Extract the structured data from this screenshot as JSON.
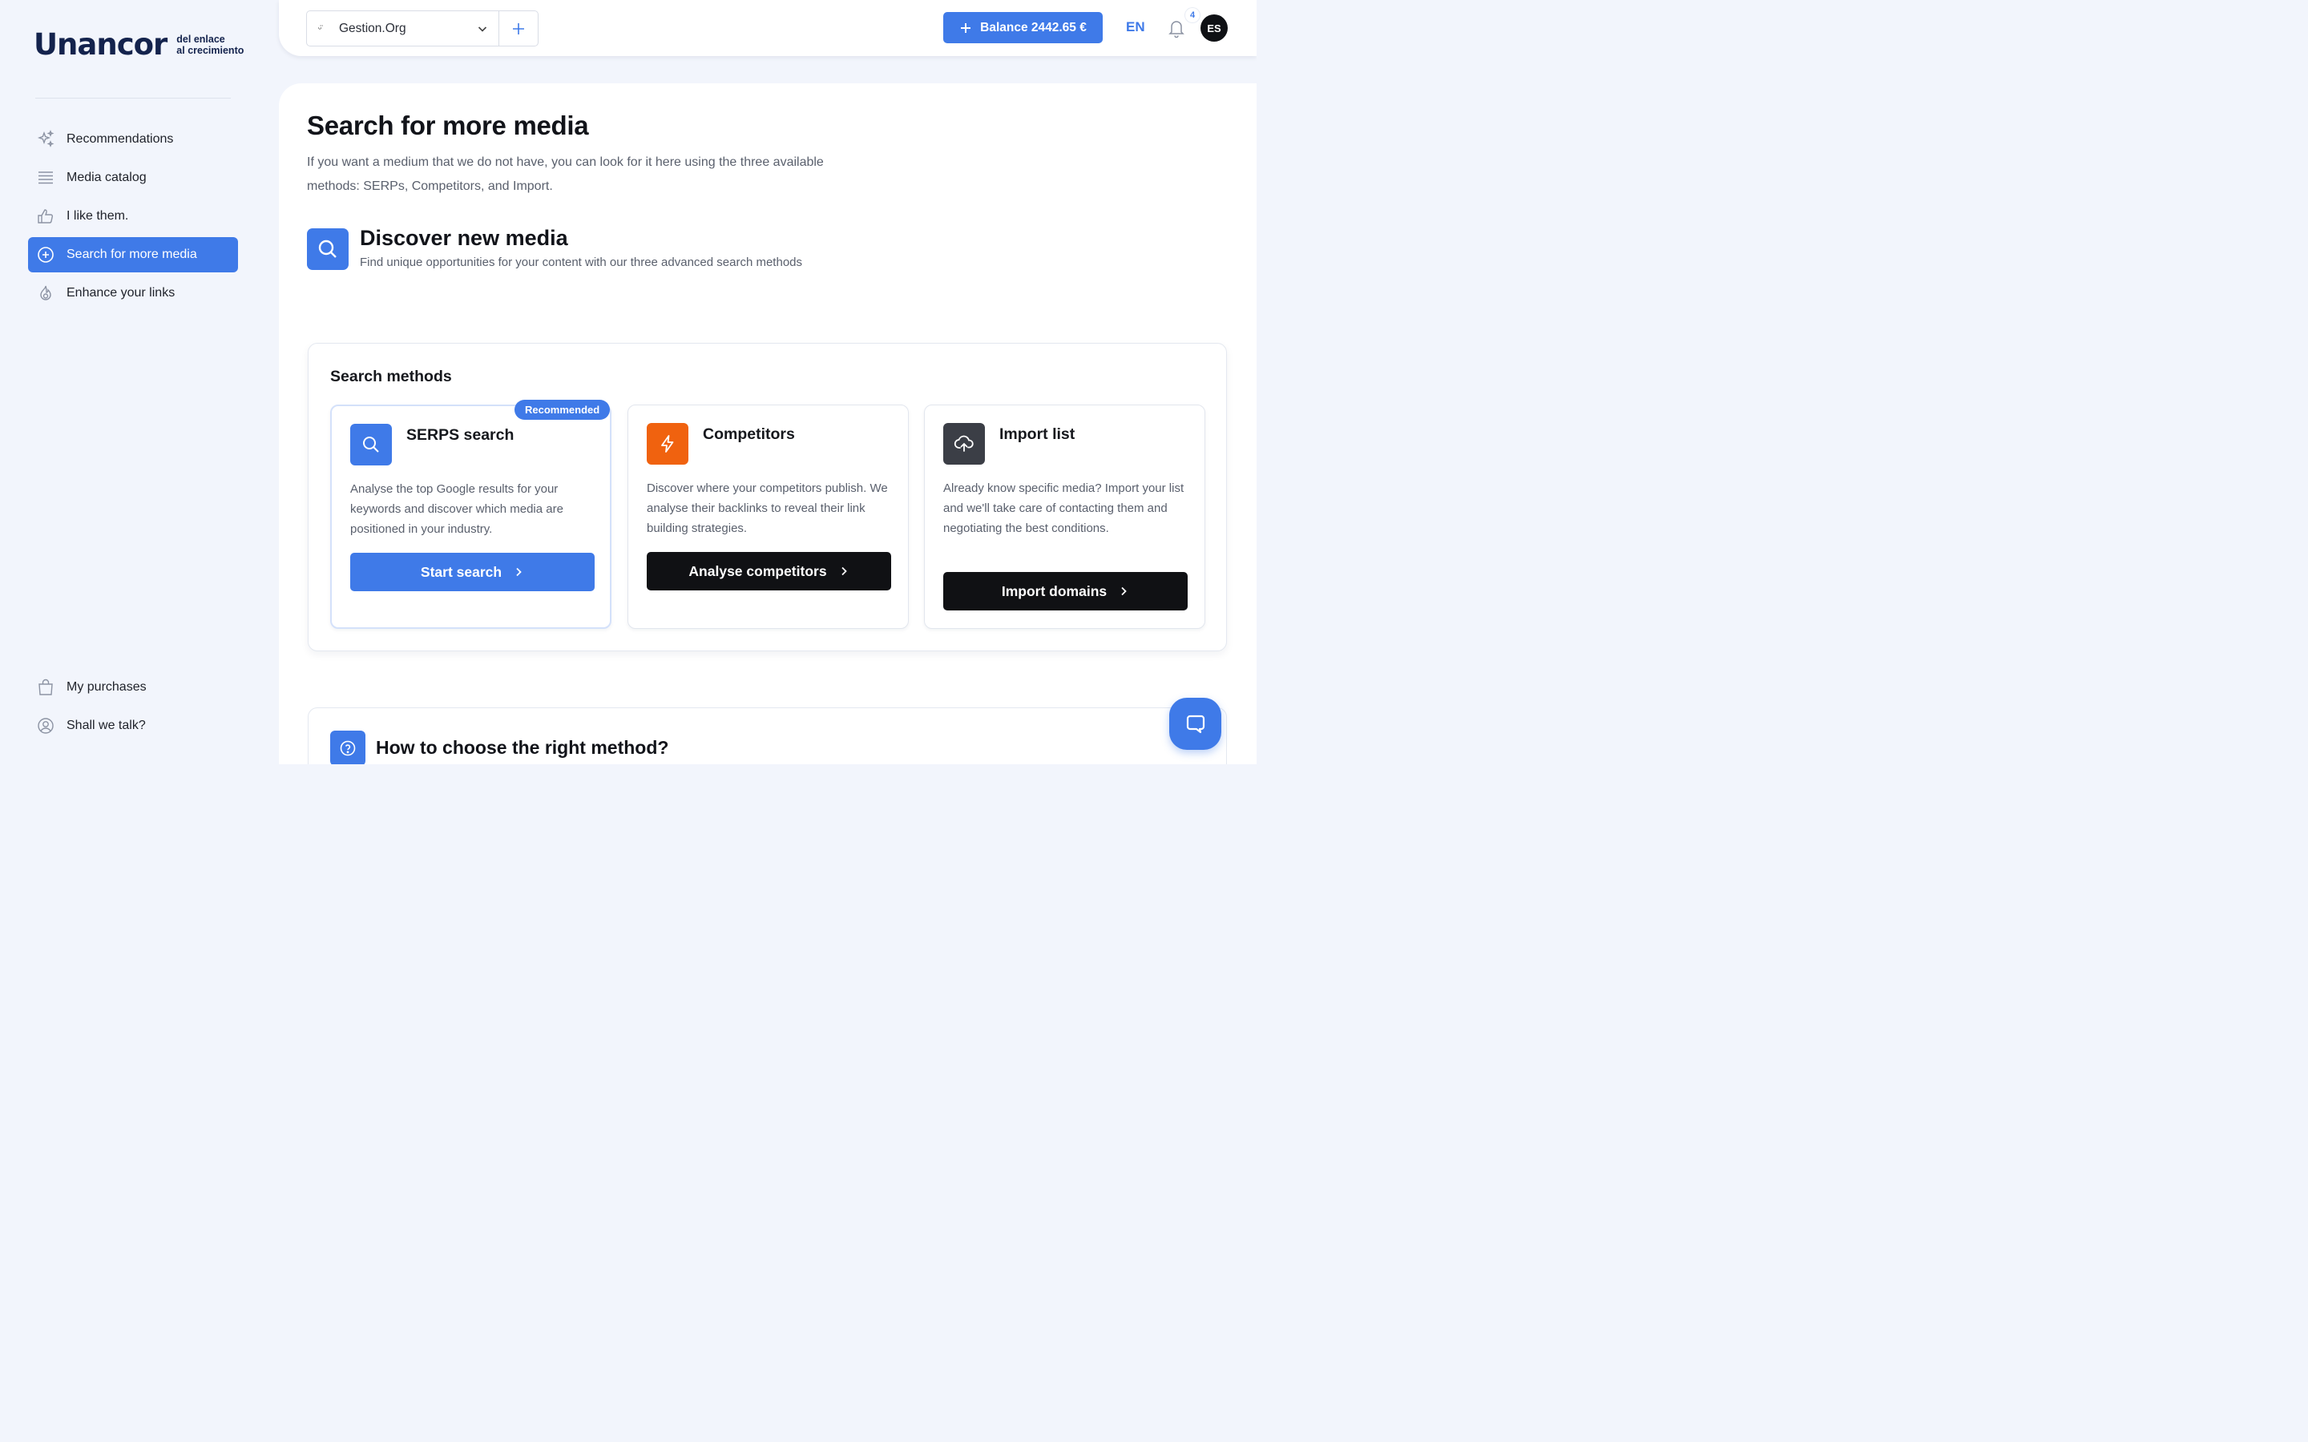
{
  "brand": {
    "name": "Unancor",
    "tagline_line1": "del enlace",
    "tagline_line2": "al crecimiento"
  },
  "sidebar": {
    "items": [
      {
        "label": "Recommendations",
        "icon": "sparkles-icon"
      },
      {
        "label": "Media catalog",
        "icon": "list-icon"
      },
      {
        "label": "I like them.",
        "icon": "thumbs-up-icon"
      },
      {
        "label": "Search for more media",
        "icon": "plus-circle-icon",
        "active": true
      },
      {
        "label": "Enhance your links",
        "icon": "flame-icon"
      }
    ],
    "bottom_items": [
      {
        "label": "My purchases",
        "icon": "shopping-bag-icon"
      },
      {
        "label": "Shall we talk?",
        "icon": "user-circle-icon"
      }
    ]
  },
  "topbar": {
    "org_name": "Gestion.Org",
    "org_icon": "smiley-icon",
    "balance_label": "Balance 2442.65 €",
    "language": "EN",
    "notifications_count": "4",
    "avatar_initials": "ES"
  },
  "page": {
    "title": "Search for more media",
    "description": "If you want a medium that we do not have, you can look for it here using the three available methods: SERPs, Competitors, and Import."
  },
  "discover": {
    "title": "Discover new media",
    "subtitle": "Find unique opportunities for your content with our three advanced search methods"
  },
  "methods": {
    "title": "Search methods",
    "cards": [
      {
        "title": "SERPS search",
        "badge": "Recommended",
        "description": "Analyse the top Google results for your keywords and discover which media are positioned in your industry.",
        "button": "Start search",
        "icon": "search-icon",
        "color": "#3f7ae8"
      },
      {
        "title": "Competitors",
        "description": "Discover where your competitors publish. We analyse their backlinks to reveal their link building strategies.",
        "button": "Analyse competitors",
        "icon": "lightning-icon",
        "color": "#f0620f"
      },
      {
        "title": "Import list",
        "description": "Already know specific media? Import your list and we'll take care of contacting them and negotiating the best conditions.",
        "button": "Import domains",
        "icon": "upload-cloud-icon",
        "color": "#3b3e46"
      }
    ]
  },
  "howto": {
    "title": "How to choose the right method?",
    "icon": "help-circle-icon"
  },
  "colors": {
    "accent": "#3f7ae8",
    "dark_button": "#101114",
    "orange": "#f0620f"
  }
}
